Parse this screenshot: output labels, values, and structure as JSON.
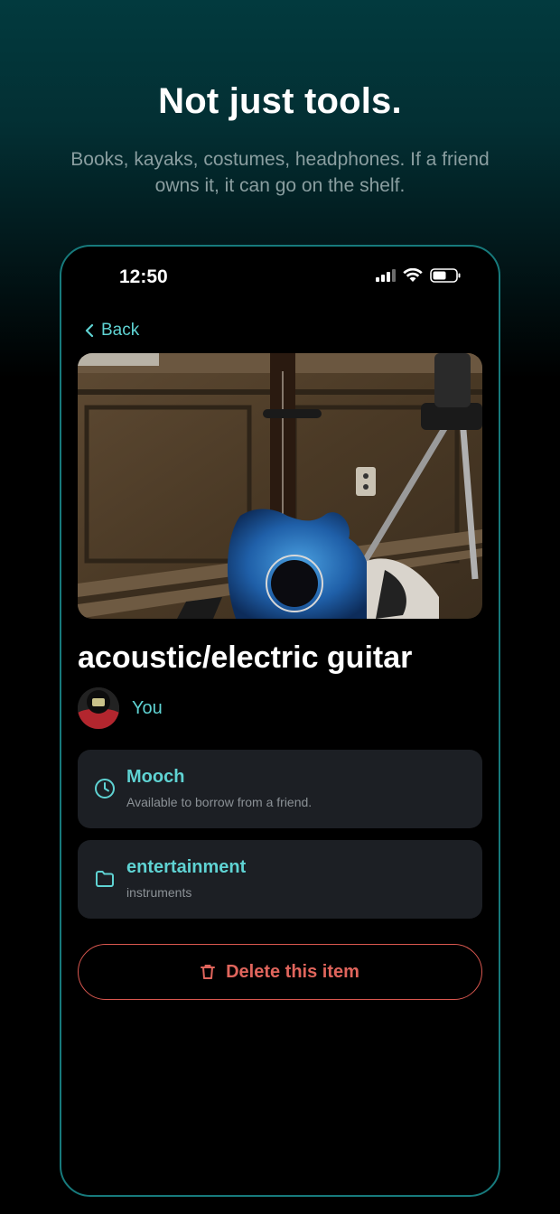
{
  "promo": {
    "headline": "Not just tools.",
    "subline": "Books, kayaks, costumes, headphones. If a friend owns it, it can go on the shelf."
  },
  "status_bar": {
    "time": "12:50"
  },
  "nav": {
    "back_label": "Back"
  },
  "item": {
    "title": "acoustic/electric guitar",
    "owner": "You",
    "photo_subject": "guitar photo"
  },
  "cards": [
    {
      "icon": "clock-icon",
      "title": "Mooch",
      "subtitle": "Available to borrow from a friend."
    },
    {
      "icon": "folder-icon",
      "title": "entertainment",
      "subtitle": "instruments"
    }
  ],
  "actions": {
    "delete_label": "Delete this item"
  },
  "colors": {
    "accent": "#5fd3d3",
    "danger": "#e0655c",
    "frame": "#177a7c",
    "card_bg": "#1c1f24"
  }
}
